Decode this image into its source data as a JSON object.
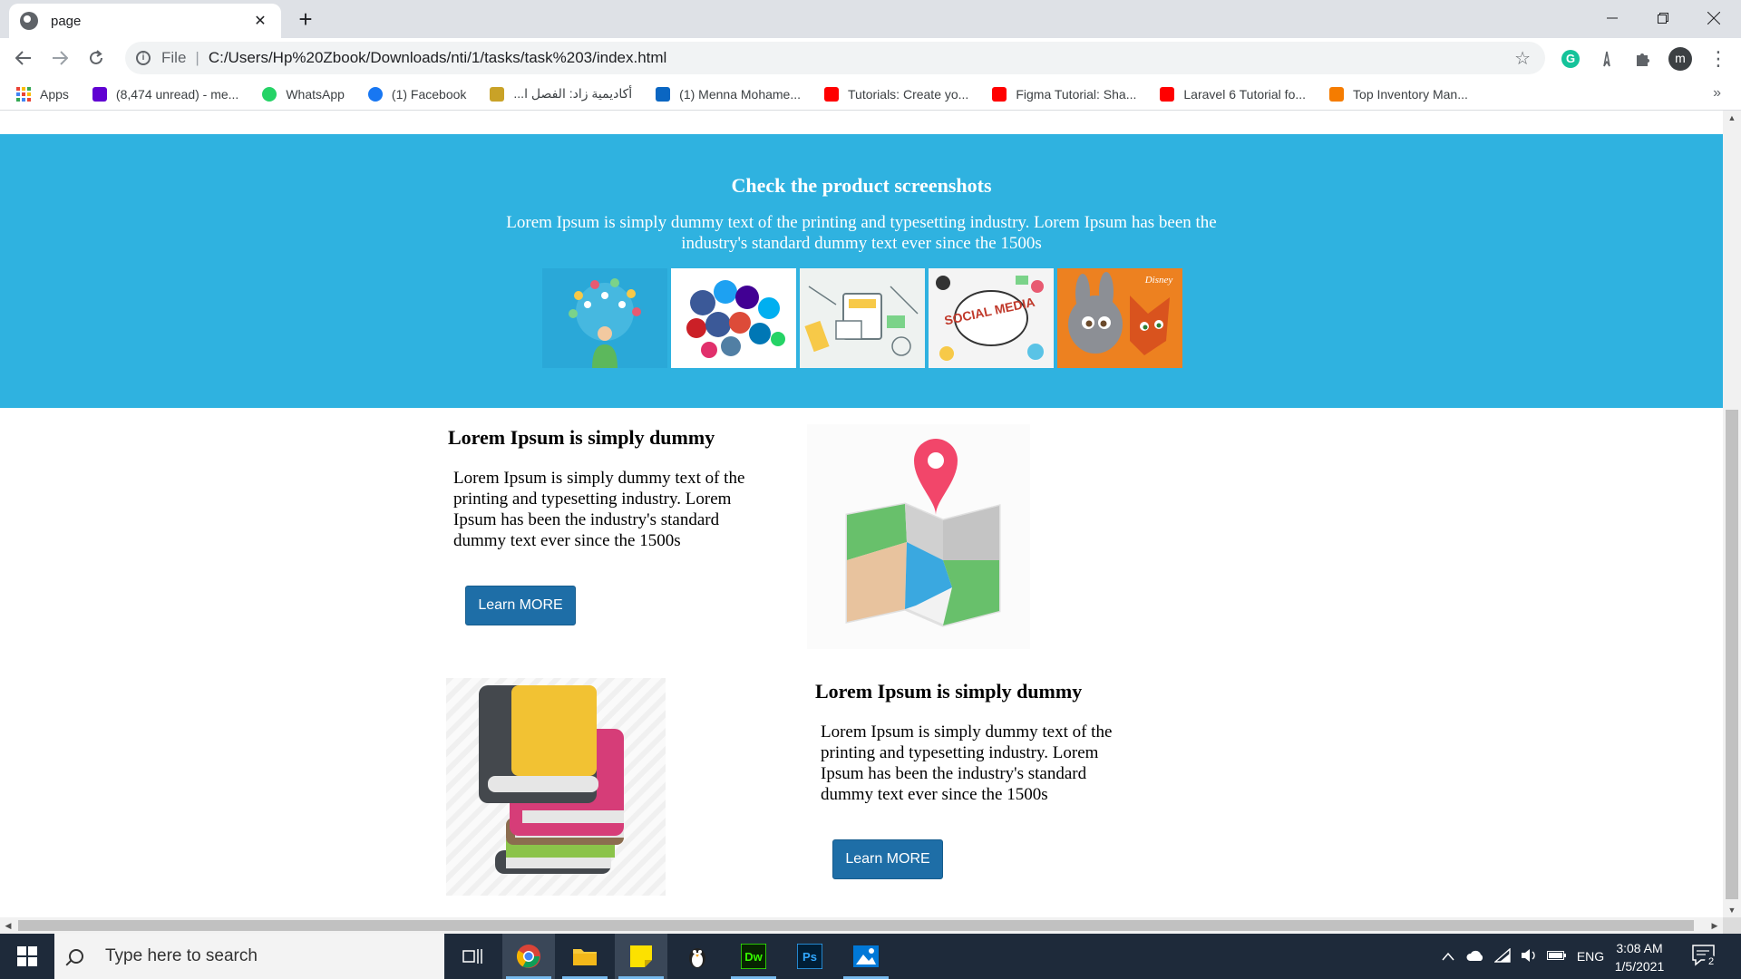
{
  "browser": {
    "tab_title": "page",
    "tab_close": "✕",
    "new_tab": "+",
    "address_scheme": "File",
    "address_url": "C:/Users/Hp%20Zbook/Downloads/nti/1/tasks/task%203/index.html",
    "profile_initial": "m"
  },
  "bookmarks": [
    {
      "label": "Apps",
      "color": "#ea4335"
    },
    {
      "label": "(8,474 unread) - me...",
      "color": "#6001d2"
    },
    {
      "label": "WhatsApp",
      "color": "#25d366"
    },
    {
      "label": "(1) Facebook",
      "color": "#1877f2"
    },
    {
      "label": "أكاديمية زاد: الفصل ا...",
      "color": "#c9a227"
    },
    {
      "label": "(1) Menna Mohame...",
      "color": "#0a66c2"
    },
    {
      "label": "Tutorials: Create yo...",
      "color": "#ff0000"
    },
    {
      "label": "Figma Tutorial: Sha...",
      "color": "#ff0000"
    },
    {
      "label": "Laravel 6 Tutorial fo...",
      "color": "#ff0000"
    },
    {
      "label": "Top Inventory Man...",
      "color": "#f57c00"
    }
  ],
  "hero": {
    "title": "Check the product screenshots",
    "text": "Lorem Ipsum is simply dummy text of the printing and typesetting industry. Lorem Ipsum has been the industry's standard dummy text ever since the 1500s",
    "logo_text": "SOCIAL MEDIA",
    "disney_text": "Disney"
  },
  "section1": {
    "title": "Lorem Ipsum is simply dummy",
    "text": "Lorem Ipsum is simply dummy text of the printing and typesetting industry. Lorem Ipsum has been the industry's standard dummy text ever since the 1500s",
    "button": "Learn MORE"
  },
  "section2": {
    "title": "Lorem Ipsum is simply dummy",
    "text": "Lorem Ipsum is simply dummy text of the printing and typesetting industry. Lorem Ipsum has been the industry's standard dummy text ever since the 1500s",
    "button": "Learn MORE"
  },
  "taskbar": {
    "search_placeholder": "Type here to search",
    "language": "ENG",
    "time": "3:08 AM",
    "date": "1/5/2021",
    "notification_count": "2",
    "dw_label": "Dw",
    "ps_label": "Ps"
  }
}
